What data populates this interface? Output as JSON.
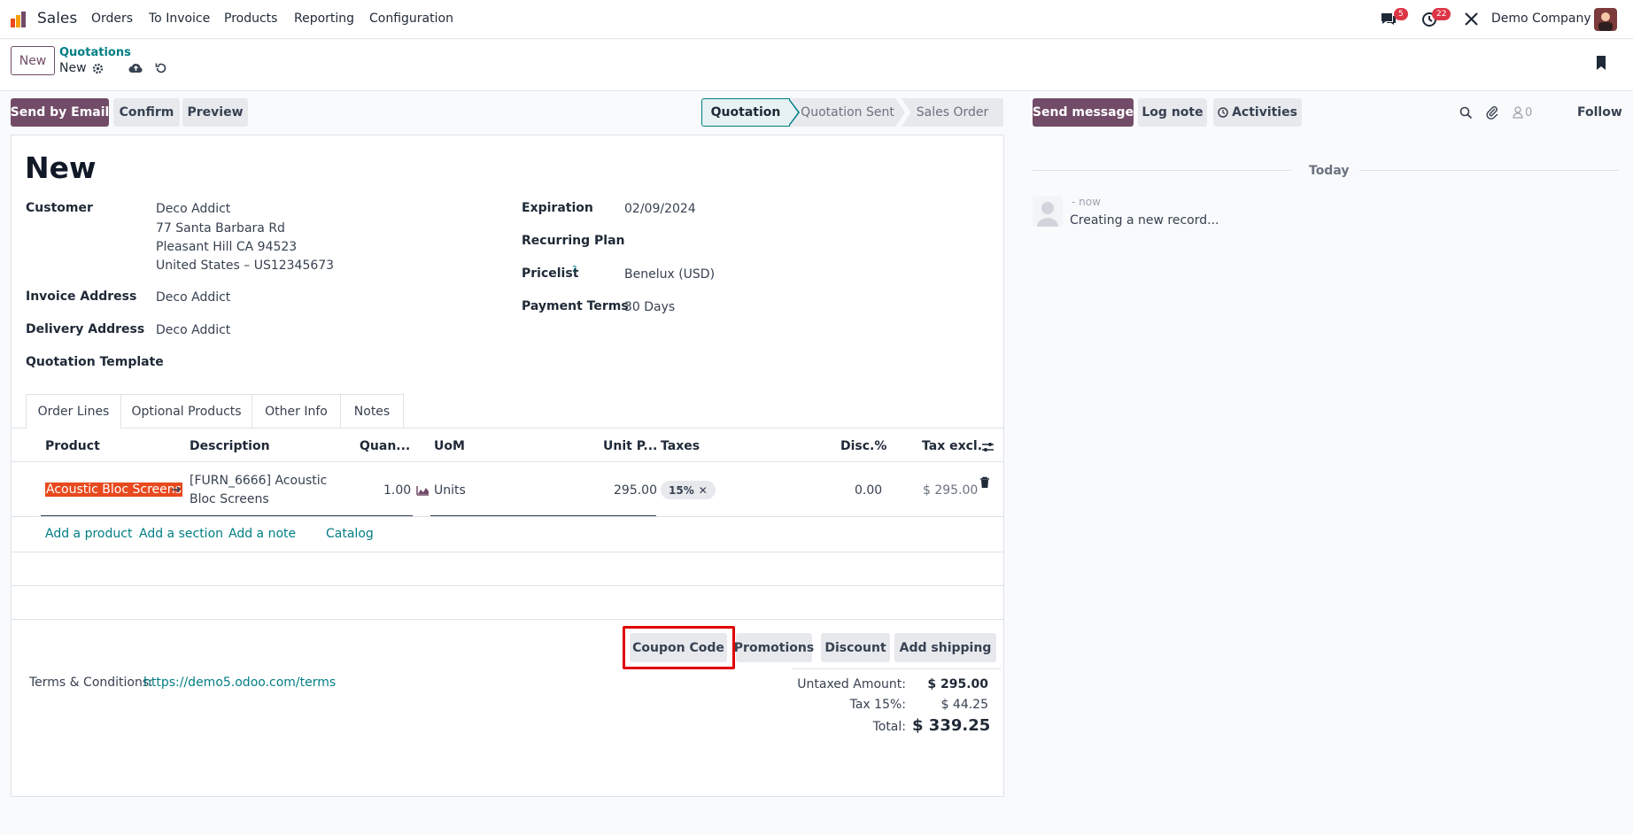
{
  "nav": {
    "app": "Sales",
    "menu": [
      "Orders",
      "To Invoice",
      "Products",
      "Reporting",
      "Configuration"
    ],
    "messages_badge": "5",
    "activities_badge": "22",
    "company": "Demo Company"
  },
  "control": {
    "new_button": "New",
    "breadcrumb_parent": "Quotations",
    "breadcrumb_current": "New"
  },
  "actions": {
    "send_email": "Send by Email",
    "confirm": "Confirm",
    "preview": "Preview"
  },
  "stages": [
    "Quotation",
    "Quotation Sent",
    "Sales Order"
  ],
  "active_stage": "Quotation",
  "form": {
    "title": "New",
    "customer_label": "Customer",
    "customer_name": "Deco Addict",
    "customer_addr1": "77 Santa Barbara Rd",
    "customer_addr2": "Pleasant Hill CA 94523",
    "customer_addr3": "United States – US12345673",
    "invoice_label": "Invoice Address",
    "invoice_value": "Deco Addict",
    "delivery_label": "Delivery Address",
    "delivery_value": "Deco Addict",
    "template_label": "Quotation Template",
    "expiration_label": "Expiration",
    "expiration_value": "02/09/2024",
    "recurring_label": "Recurring Plan",
    "pricelist_label": "Pricelist",
    "pricelist_help": "?",
    "pricelist_value": "Benelux (USD)",
    "terms_label": "Payment Terms",
    "terms_value": "30 Days"
  },
  "tabs": [
    "Order Lines",
    "Optional Products",
    "Other Info",
    "Notes"
  ],
  "table": {
    "headers": {
      "product": "Product",
      "description": "Description",
      "quantity": "Quan...",
      "uom": "UoM",
      "unit_price": "Unit P...",
      "taxes": "Taxes",
      "disc": "Disc.%",
      "tax_excl": "Tax excl."
    },
    "row": {
      "product": "Acoustic Bloc Screens",
      "description_line1": "[FURN_6666] Acoustic",
      "description_line2": "Bloc Screens",
      "quantity": "1.00",
      "uom": "Units",
      "unit_price": "295.00",
      "tax": "15%",
      "disc": "0.00",
      "subtotal": "$ 295.00"
    },
    "add_product": "Add a product",
    "add_section": "Add a section",
    "add_note": "Add a note",
    "catalog": "Catalog"
  },
  "reward_buttons": {
    "coupon": "Coupon Code",
    "promotions": "Promotions",
    "discount": "Discount",
    "shipping": "Add shipping"
  },
  "terms": {
    "label": "Terms & Conditions:",
    "link": "https://demo5.odoo.com/terms"
  },
  "totals": {
    "untaxed_label": "Untaxed Amount:",
    "untaxed_value": "$ 295.00",
    "tax_label": "Tax 15%:",
    "tax_value": "$ 44.25",
    "total_label": "Total:",
    "total_value": "$ 339.25"
  },
  "chatter": {
    "send_message": "Send message",
    "log_note": "Log note",
    "activities": "Activities",
    "followers_count": "0",
    "follow": "Follow",
    "today": "Today",
    "time": "- now",
    "message": "Creating a new record..."
  },
  "colors": {
    "primary": "#714b67",
    "link": "#017e84",
    "highlight": "#e8491d",
    "annotation": "#e00000"
  }
}
